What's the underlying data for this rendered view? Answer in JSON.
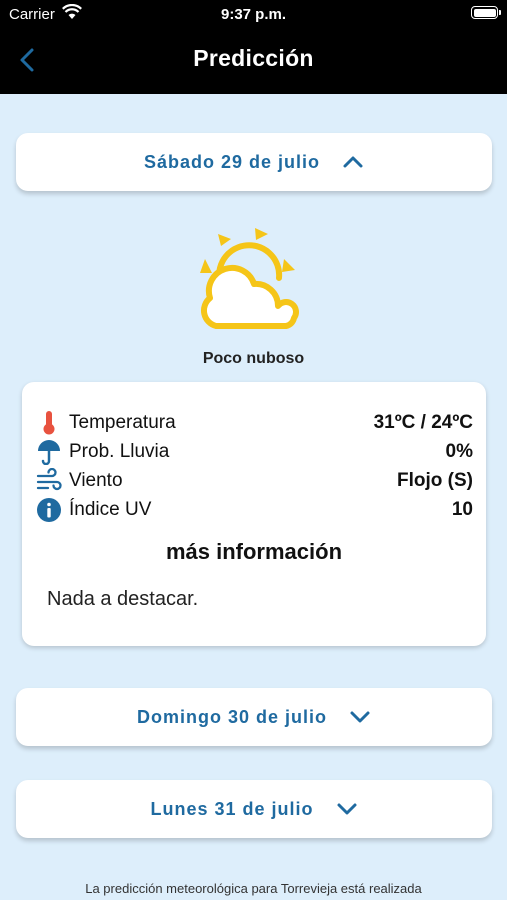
{
  "status": {
    "carrier": "Carrier",
    "time": "9:37 p.m."
  },
  "nav": {
    "title": "Predicción"
  },
  "days": [
    {
      "label": "Sábado 29 de julio",
      "expanded": true
    },
    {
      "label": "Domingo 30 de julio",
      "expanded": false
    },
    {
      "label": "Lunes 31 de julio",
      "expanded": false
    }
  ],
  "forecast": {
    "icon": "sun-behind-cloud-icon",
    "description": "Poco nuboso",
    "rows": [
      {
        "icon": "thermometer-icon",
        "label": "Temperatura",
        "value": "31ºC / 24ºC"
      },
      {
        "icon": "umbrella-icon",
        "label": "Prob. Lluvia",
        "value": "0%"
      },
      {
        "icon": "wind-icon",
        "label": "Viento",
        "value": "Flojo (S)"
      },
      {
        "icon": "info-icon",
        "label": "Índice UV",
        "value": "10"
      }
    ],
    "more_title": "más información",
    "more_text": "Nada a destacar."
  },
  "footer": {
    "text": "La predicción meteorológica para Torrevieja está realizada"
  },
  "colors": {
    "accent": "#1f6aa0",
    "sun": "#f5c518",
    "background": "#ddeefb",
    "thermometer": "#e8523f"
  }
}
